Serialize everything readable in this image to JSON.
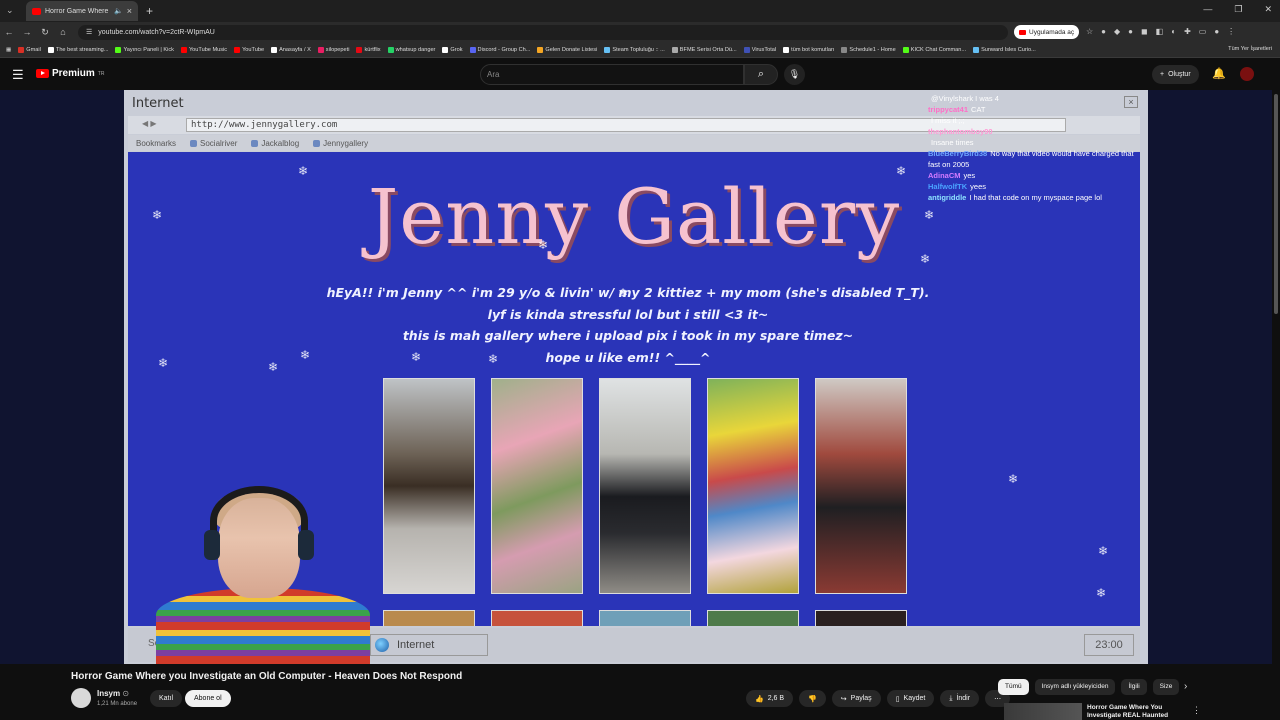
{
  "browser": {
    "tab_title": "Horror Game Where you Inv",
    "url": "youtube.com/watch?v=2ctR-WIpmAU",
    "open_in_app": "Uygulamada aç",
    "bookmarks": [
      {
        "label": "Gmail",
        "color": "#d93025"
      },
      {
        "label": "The best streaming...",
        "color": "#ffffff"
      },
      {
        "label": "Yayıncı Paneli | Kick",
        "color": "#53fc18"
      },
      {
        "label": "YouTube Music",
        "color": "#ff0000"
      },
      {
        "label": "YouTube",
        "color": "#ff0000"
      },
      {
        "label": "Anasayfa / X",
        "color": "#ffffff"
      },
      {
        "label": "silopepeti",
        "color": "#e91e63"
      },
      {
        "label": "kürtflix",
        "color": "#e50914"
      },
      {
        "label": "whatsup danger",
        "color": "#25d366"
      },
      {
        "label": "Grok",
        "color": "#ffffff"
      },
      {
        "label": "Discord - Group Ch...",
        "color": "#5865f2"
      },
      {
        "label": "Gelen Donate Listesi",
        "color": "#f5a623"
      },
      {
        "label": "Steam Topluluğu :: ...",
        "color": "#66c0f4"
      },
      {
        "label": "BFME Serisi Orta Dü...",
        "color": "#aaaaaa"
      },
      {
        "label": "VirusTotal",
        "color": "#3f51b5"
      },
      {
        "label": "tüm bot komutları",
        "color": "#ffffff"
      },
      {
        "label": "Schedule1 - Home",
        "color": "#888888"
      },
      {
        "label": "KICK Chat Comman...",
        "color": "#53fc18"
      },
      {
        "label": "Sunward Isles Curio...",
        "color": "#66c0f4"
      }
    ],
    "bookmarks_right": "Tüm Yer İşaretleri"
  },
  "youtube": {
    "brand": "Premium",
    "brand_sup": "TR",
    "search_placeholder": "Ara",
    "create_label": "Oluştur"
  },
  "ie": {
    "window_title": "Internet",
    "address": "http://www.jennygallery.com",
    "bookmarks_label": "Bookmarks",
    "links": [
      "Socialriver",
      "Jackalblog",
      "Jennygallery"
    ],
    "status_label": "Internet",
    "start_label": "Se",
    "clock": "23:00"
  },
  "jenny_page": {
    "title": "Jenny Gallery",
    "intro_lines": [
      "hEyA!! i'm Jenny ^^ i'm 29 y/o & livin' w/ my 2 kittiez + my mom (she's disabled T_T).",
      "lyf is kinda stressful lol but i still <3 it~",
      "this is mah gallery where i upload pix i took in my spare timez~",
      "hope u like em!! ^____^"
    ]
  },
  "chat": [
    {
      "name": "",
      "name_color": "#a66cff",
      "msg": "@Vinylshark I was 4"
    },
    {
      "name": "trippycat41",
      "name_color": "#ff6ec7",
      "msg": "CAT"
    },
    {
      "name": "",
      "name_color": "#ff7eb6",
      "msg": "I miss it ;.;"
    },
    {
      "name": "thephantomboy90",
      "name_color": "#ff9ad5",
      "msg": ""
    },
    {
      "name": "",
      "name_color": "#66d06a",
      "msg": "Insane times"
    },
    {
      "name": "BlueBerryBird38",
      "name_color": "#6fa8ff",
      "msg": "No way that video would have charged that fast on 2005"
    },
    {
      "name": "AdinaCM",
      "name_color": "#d57bff",
      "msg": "yes"
    },
    {
      "name": "HalfwolfTK",
      "name_color": "#4aa3ff",
      "msg": "yees"
    },
    {
      "name": "antigriddle",
      "name_color": "#8ee4ff",
      "msg": "I had that code on my myspace page lol"
    }
  ],
  "video": {
    "title": "Horror Game Where you Investigate an Old Computer - Heaven Does Not Respond",
    "channel": "Insym",
    "subs": "1,21 Mn abone",
    "join": "Katıl",
    "subscribe": "Abone ol",
    "likes": "2,6 B",
    "share": "Paylaş",
    "save": "Kaydet",
    "download": "İndir"
  },
  "filters": [
    "Tümü",
    "Insym adlı yükleyiciden",
    "İlgili",
    "Size"
  ],
  "recommendation": {
    "title": "Horror Game Where You Investigate REAL Haunted"
  }
}
